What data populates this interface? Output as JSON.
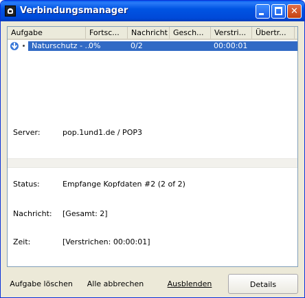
{
  "window": {
    "title": "Verbindungsmanager"
  },
  "list": {
    "columns": [
      "Aufgabe",
      "Fortsc...",
      "Nachricht",
      "Gesch...",
      "Verstri...",
      "Übertr..."
    ],
    "rows": [
      {
        "task": "Naturschutz - ...",
        "progress": "0%",
        "message": "0/2",
        "speed": "",
        "elapsed": "00:00:01",
        "transferred": ""
      }
    ]
  },
  "details": {
    "server_label": "Server:",
    "server_value": "pop.1und1.de / POP3",
    "status_label": "Status:",
    "status_value": "Empfange Kopfdaten #2 (2 of 2)",
    "message_label": "Nachricht:",
    "message_value": "[Gesamt: 2]",
    "time_label": "Zeit:",
    "time_value": "[Verstrichen: 00:00:01]"
  },
  "buttons": {
    "delete_task": "Aufgabe löschen",
    "cancel_all": "Alle abbrechen",
    "hide": "Ausblenden",
    "details": "Details"
  },
  "colors": {
    "selection": "#316ac5",
    "titlebar": "#0054e3"
  }
}
